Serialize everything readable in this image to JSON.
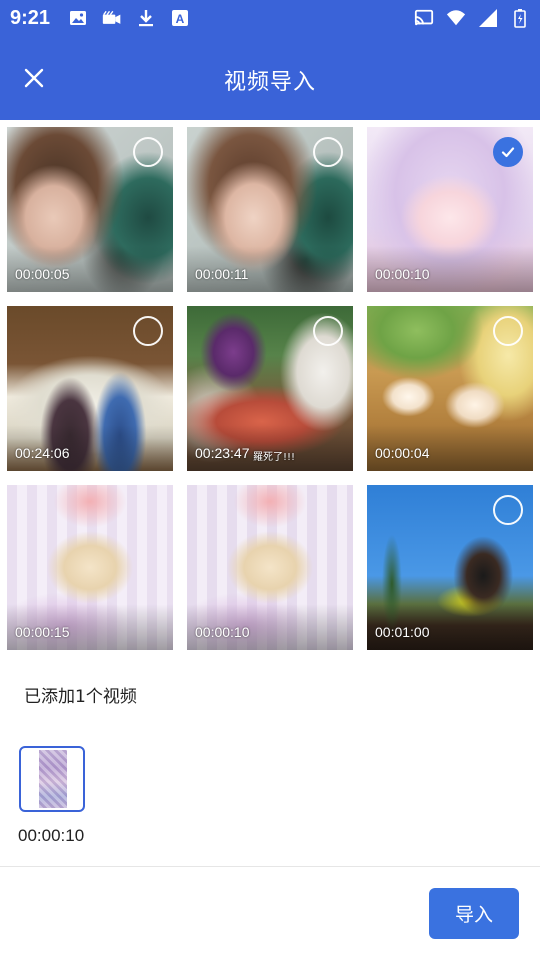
{
  "status_bar": {
    "time": "9:21",
    "left_icons": [
      "image-icon",
      "video-camera-icon",
      "download-icon",
      "app-a-icon"
    ],
    "right_icons": [
      "cast-icon",
      "wifi-icon",
      "signal-icon",
      "battery-icon"
    ]
  },
  "app_bar": {
    "title": "视频导入",
    "close_icon": "close-icon",
    "color": "#3a63d8"
  },
  "videos": [
    {
      "duration": "00:00:05",
      "selected": false
    },
    {
      "duration": "00:00:11",
      "selected": false
    },
    {
      "duration": "00:00:10",
      "selected": true
    },
    {
      "duration": "00:24:06",
      "selected": false
    },
    {
      "duration": "00:23:47",
      "selected": false,
      "overlay_text": "羅死了!!!"
    },
    {
      "duration": "00:00:04",
      "selected": false
    },
    {
      "duration": "00:00:15",
      "selected": false
    },
    {
      "duration": "00:00:10",
      "selected": false
    },
    {
      "duration": "00:01:00",
      "selected": false
    }
  ],
  "added": {
    "label": "已添加1个视频",
    "items": [
      {
        "duration": "00:00:10"
      }
    ]
  },
  "import_button": {
    "label": "导入",
    "color": "#3a72e0"
  }
}
